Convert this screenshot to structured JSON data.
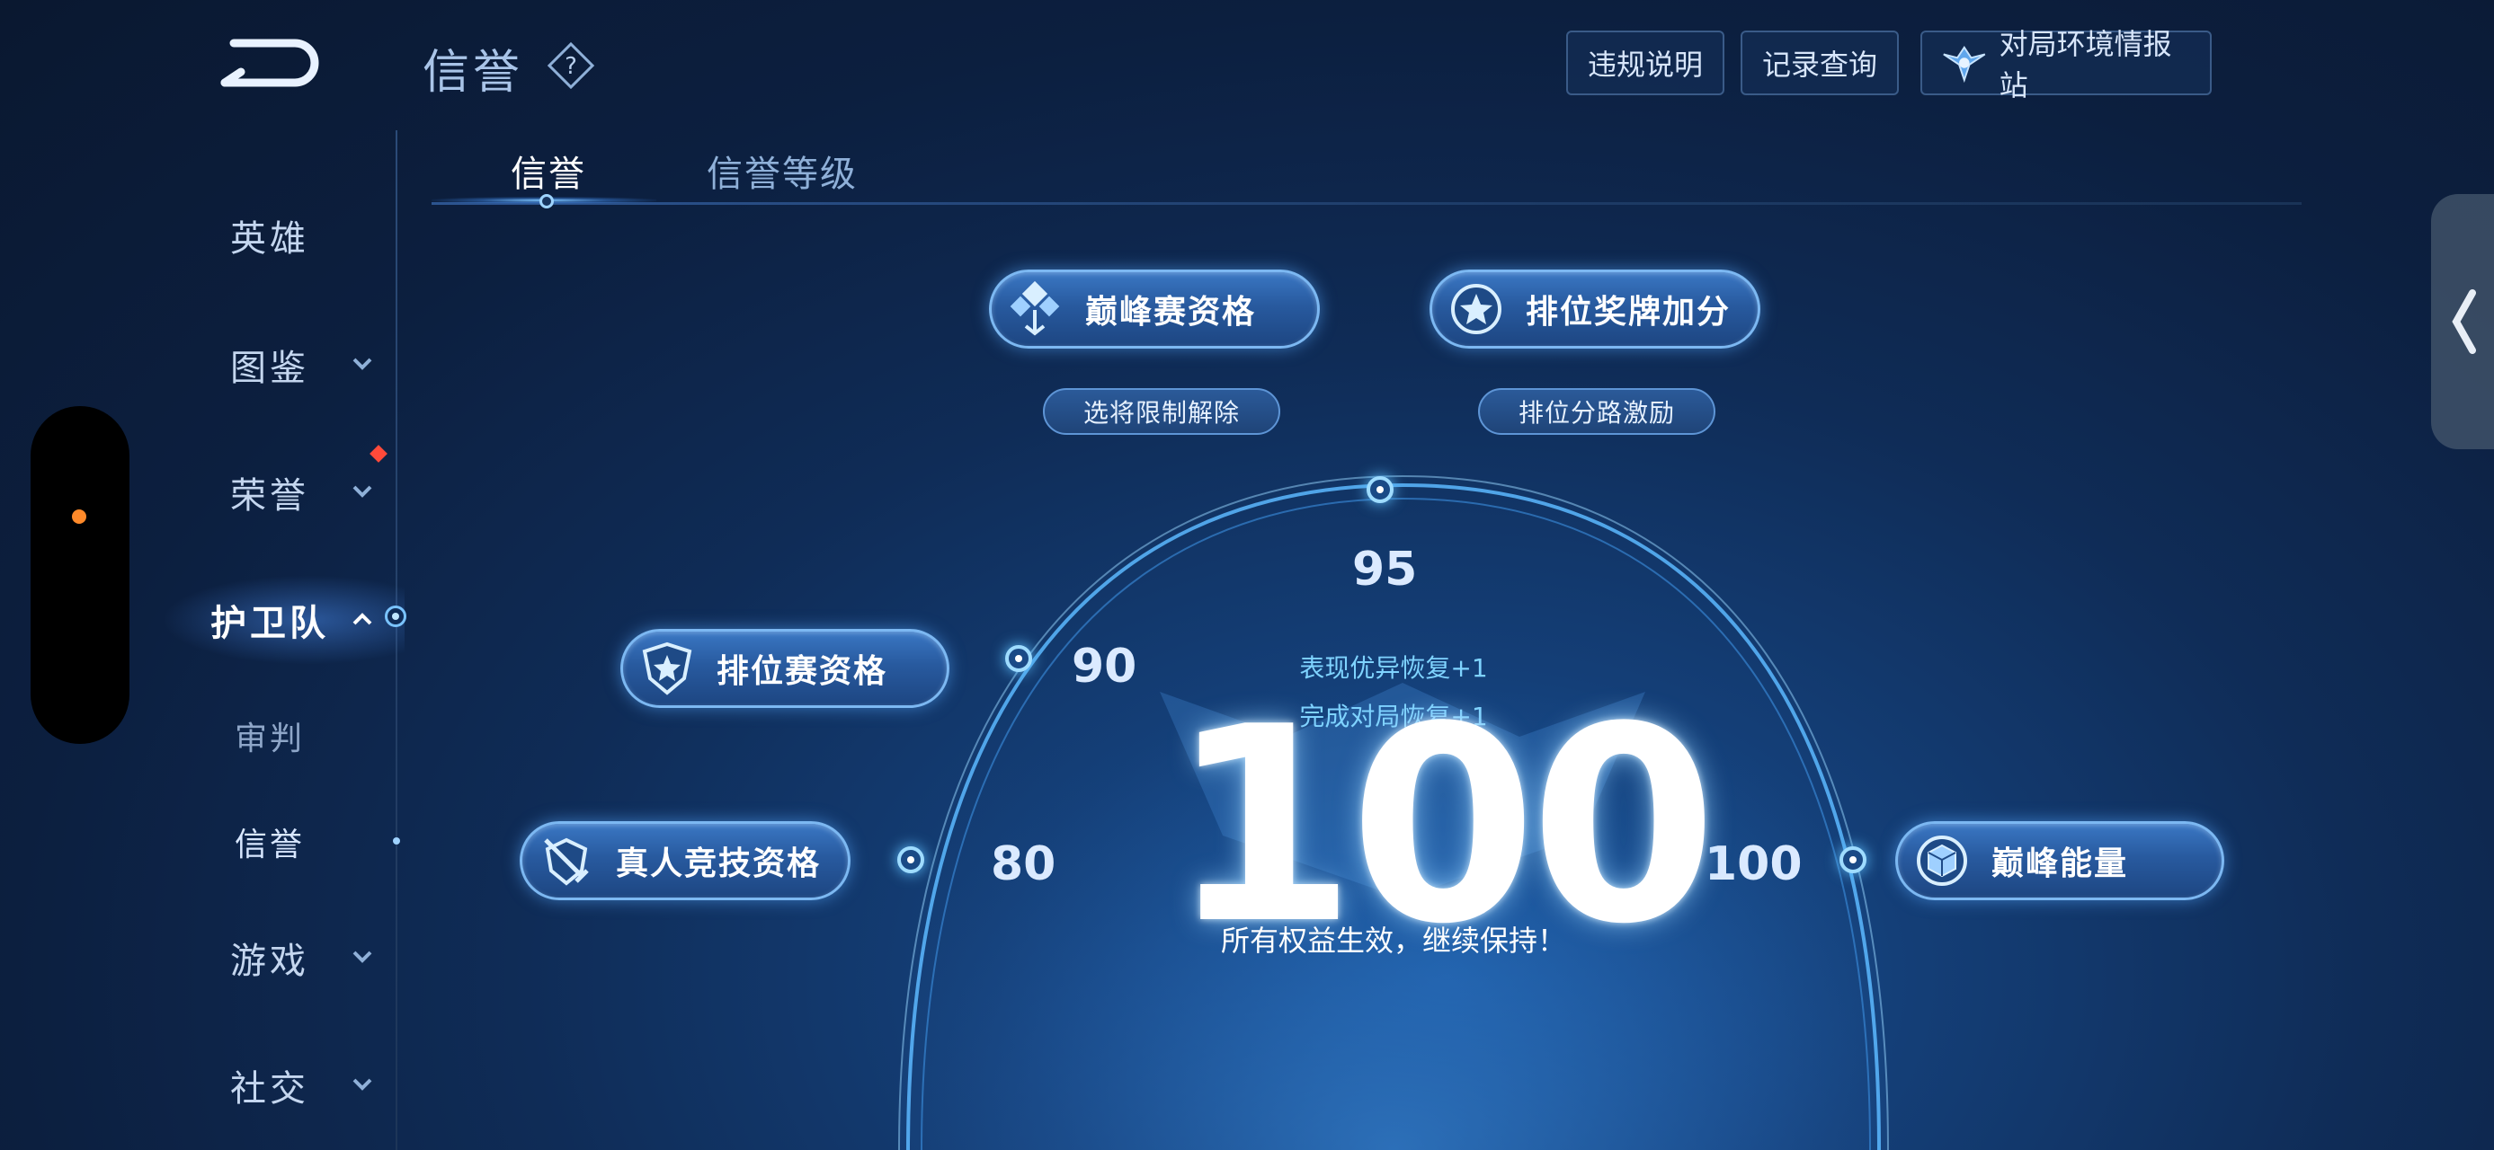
{
  "header": {
    "title": "信誉",
    "buttons": [
      {
        "label": "违规说明"
      },
      {
        "label": "记录查询"
      },
      {
        "label": "对局环境情报站",
        "icon": "wings-emblem-icon"
      }
    ]
  },
  "sidebar": {
    "items": [
      {
        "label": "英雄"
      },
      {
        "label": "图鉴"
      },
      {
        "label": "荣誉"
      },
      {
        "label": "护卫队"
      },
      {
        "label": "审判"
      },
      {
        "label": "信誉"
      },
      {
        "label": "游戏"
      },
      {
        "label": "社交"
      }
    ]
  },
  "tabs": [
    {
      "label": "信誉",
      "active": true
    },
    {
      "label": "信誉等级",
      "active": false
    }
  ],
  "benefits": {
    "peak_match": {
      "label": "巅峰赛资格",
      "tag": "选将限制解除"
    },
    "rank_medal": {
      "label": "排位奖牌加分",
      "tag": "排位分路激励"
    },
    "ranked_match": {
      "label": "排位赛资格"
    },
    "pvp_match": {
      "label": "真人竞技资格"
    },
    "peak_energy": {
      "label": "巅峰能量"
    }
  },
  "gauge": {
    "ticks": {
      "t80": "80",
      "t90": "90",
      "t95": "95",
      "t100": "100"
    },
    "score": "100",
    "recover_1": "表现优异恢复+1",
    "recover_2": "完成对局恢复+1",
    "note": "所有权益生效，继续保持！"
  },
  "colors": {
    "accent": "#7cb8f2",
    "recover_text": "#7fd3ff",
    "badge_red": "#ff4a3a",
    "status_orange": "#ff8a2a"
  }
}
